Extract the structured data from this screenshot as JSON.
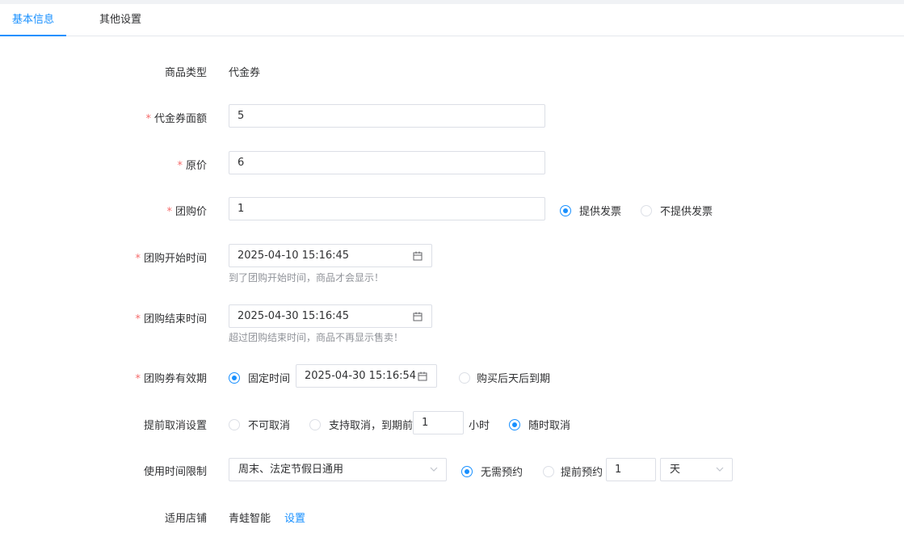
{
  "tabs": [
    {
      "label": "基本信息",
      "active": true
    },
    {
      "label": "其他设置",
      "active": false
    }
  ],
  "colors": {
    "accent": "#1890ff",
    "required": "#f56c6c",
    "hint": "#909399",
    "border": "#dcdfe6"
  },
  "form": {
    "product_type": {
      "label": "商品类型",
      "value": "代金券"
    },
    "face_value": {
      "required_mark": "*",
      "label": "代金券面额",
      "value": "5"
    },
    "original_price": {
      "required_mark": "*",
      "label": "原价",
      "value": "6"
    },
    "group_price": {
      "required_mark": "*",
      "label": "团购价",
      "value": "1"
    },
    "invoice": {
      "options": [
        {
          "label": "提供发票",
          "checked": true
        },
        {
          "label": "不提供发票",
          "checked": false
        }
      ]
    },
    "start_time": {
      "required_mark": "*",
      "label": "团购开始时间",
      "value": "2025-04-10 15:16:45",
      "hint": "到了团购开始时间，商品才会显示！",
      "icon": "calendar-icon"
    },
    "end_time": {
      "required_mark": "*",
      "label": "团购结束时间",
      "value": "2025-04-30 15:16:45",
      "hint": "超过团购结束时间，商品不再显示售卖！",
      "icon": "calendar-icon"
    },
    "validity": {
      "required_mark": "*",
      "label": "团购券有效期",
      "fixed": {
        "label": "固定时间",
        "checked": true,
        "value": "2025-04-30 15:16:54"
      },
      "after_purchase": {
        "label": "购买后天后到期",
        "checked": false
      }
    },
    "cancel": {
      "label": "提前取消设置",
      "no_cancel": {
        "label": "不可取消",
        "checked": false
      },
      "support": {
        "label": "支持取消，到期前",
        "checked": false,
        "hours": "1",
        "unit": "小时"
      },
      "anytime": {
        "label": "随时取消",
        "checked": true
      }
    },
    "usage": {
      "label": "使用时间限制",
      "select_value": "周末、法定节假日通用",
      "no_reservation": {
        "label": "无需预约",
        "checked": true
      },
      "advance": {
        "label": "提前预约",
        "checked": false,
        "amount": "1",
        "unit": "天"
      }
    },
    "stores": {
      "label": "适用店铺",
      "value": "青蛙智能",
      "action": "设置"
    }
  }
}
